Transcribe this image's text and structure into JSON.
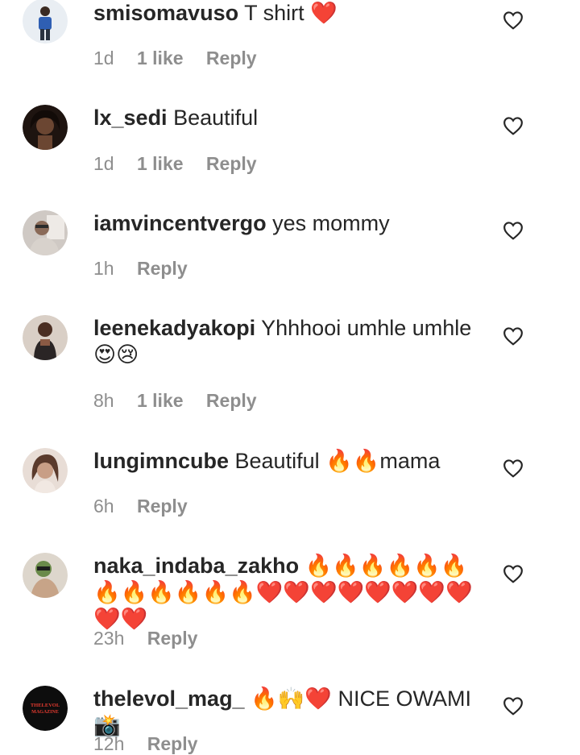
{
  "comments": [
    {
      "username": "smisomavuso",
      "text": "T shirt ❤️",
      "time": "1d",
      "likes": "1 like",
      "reply": "Reply",
      "avatar": "avatar-smisomavuso"
    },
    {
      "username": "lx_sedi",
      "text": "Beautiful",
      "time": "1d",
      "likes": "1 like",
      "reply": "Reply",
      "avatar": "avatar-lx-sedi"
    },
    {
      "username": "iamvincentvergo",
      "text": "yes mommy",
      "time": "1h",
      "likes": "",
      "reply": "Reply",
      "avatar": "avatar-iamvincentvergo"
    },
    {
      "username": "leenekadyakopi",
      "text": "Yhhhooi umhle umhle 😍😢",
      "time": "8h",
      "likes": "1 like",
      "reply": "Reply",
      "avatar": "avatar-leenekadyakopi"
    },
    {
      "username": "lungimncube",
      "text": "Beautiful 🔥🔥mama",
      "time": "6h",
      "likes": "",
      "reply": "Reply",
      "avatar": "avatar-lungimncube"
    },
    {
      "username": "naka_indaba_zakho",
      "text": "🔥🔥🔥🔥🔥🔥🔥🔥🔥🔥🔥🔥❤️❤️❤️❤️❤️❤️❤️❤️❤️❤️",
      "time": "23h",
      "likes": "",
      "reply": "Reply",
      "avatar": "avatar-naka-indaba-zakho"
    },
    {
      "username": "thelevol_mag_",
      "text": "🔥🙌❤️ NICE OWAMI 📸",
      "time": "12h",
      "likes": "",
      "reply": "Reply",
      "avatar": "avatar-thelevol-mag",
      "avatar_text": "THELEVOL MAGAZINE"
    }
  ],
  "icons": {
    "like": "heart-outline-icon"
  },
  "colors": {
    "text": "#262626",
    "meta": "#8e8e8e"
  }
}
